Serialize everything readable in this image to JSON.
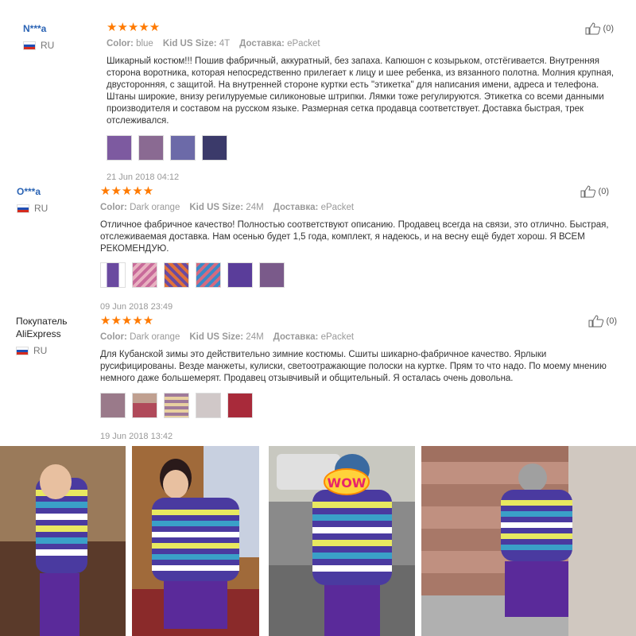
{
  "reviews": [
    {
      "user": "N***a",
      "country": "RU",
      "stars": "★★★★★",
      "color_label": "Color:",
      "color": "blue",
      "size_label": "Kid US Size:",
      "size": "4T",
      "delivery_label": "Доставка:",
      "delivery": "ePacket",
      "text": "Шикарный костюм!!! Пошив фабричный, аккуратный, без запаха. Капюшон с козырьком, отстёгивается. Внутренняя сторона воротника, которая непосредственно прилегает к лицу и шее ребенка, из вязанного полотна. Молния крупная, двусторонняя, с защитой. На внутренней стороне куртки есть \"этикетка\" для написания имени, адреса и телефона. Штаны широкие, внизу регилуруемые силиконовые штрипки. Лямки тоже регулируются. Этикетка со всеми данными производителя и составом на русском языке. Размерная сетка продавца соответствует. Доставка быстрая, трек отслеживался.",
      "date": "21 Jun 2018 04:12",
      "helpful": "(0)",
      "thumb_colors": [
        "#7d5aa0",
        "#8a6a92",
        "#6c6aa8",
        "#3b3a6a"
      ]
    },
    {
      "user": "O***a",
      "country": "RU",
      "stars": "★★★★★",
      "color_label": "Color:",
      "color": "Dark orange",
      "size_label": "Kid US Size:",
      "size": "24M",
      "delivery_label": "Доставка:",
      "delivery": "ePacket",
      "text": "Отличное фабричное качество! Полностью соответствуют описанию. Продавец всегда на связи, это отлично. Быстрая, отслеживаемая доставка. Нам осенью будет 1,5 года, комплект, я надеюсь, и на весну ещё будет хорош. Я ВСЕМ РЕКОМЕНДУЮ.",
      "date": "09 Jun 2018 23:49",
      "helpful": "(0)",
      "thumb_colors": [
        "#6a4aa0",
        "#c86a9a",
        "#e0703a",
        "#d46a80",
        "#5a3d9a",
        "#7a5a8a"
      ]
    },
    {
      "user": "Покупатель AliExpress",
      "country": "RU",
      "stars": "★★★★★",
      "color_label": "Color:",
      "color": "Dark orange",
      "size_label": "Kid US Size:",
      "size": "24M",
      "delivery_label": "Доставка:",
      "delivery": "ePacket",
      "text": "Для Кубанской зимы это действительно зимние костюмы. Сшиты шикарно-фабричное качество. Ярлыки русифицированы. Везде манжеты, кулиски, светоотражающие полоски на куртке. Прям то что надо. По моему мнению немного даже большемерят. Продавец отзывчивый и общительный. Я осталась очень довольна.",
      "date": "19 Jun 2018 13:42",
      "helpful": "(0)",
      "thumb_colors": [
        "#9a7a8a",
        "#b04a5a",
        "#a07a9a",
        "#d0c8c8",
        "#a82a3a"
      ]
    }
  ],
  "photos": {
    "wow_badge": "WOW",
    "colors": {
      "jacket_stripe1": "#4a3aa0",
      "jacket_stripe2": "#e8e860",
      "jacket_stripe3": "#3aa0c8",
      "pants": "#5a2a9a"
    }
  }
}
